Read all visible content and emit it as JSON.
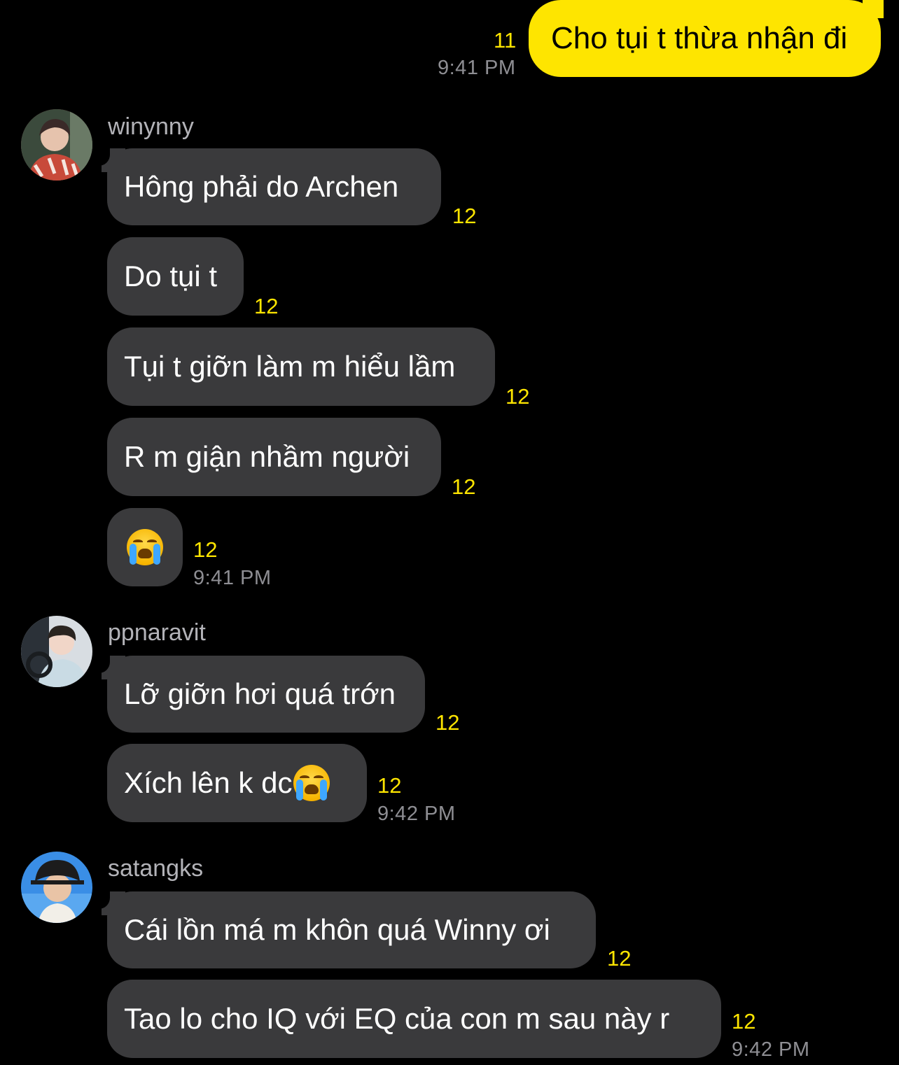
{
  "sent_message": {
    "text": "Cho tụi t thừa nhận đi",
    "read_count": "11",
    "time": "9:41 PM"
  },
  "groups": [
    {
      "sender": "winynny",
      "avatar_icon": "user-avatar-icon",
      "messages": [
        {
          "text": "Hông phải do Archen",
          "read_count": "12"
        },
        {
          "text": "Do tụi t",
          "read_count": "12"
        },
        {
          "text": "Tụi t giỡn làm m hiểu lầm",
          "read_count": "12"
        },
        {
          "text": "R m giận nhầm người",
          "read_count": "12"
        },
        {
          "text": "",
          "emoji": "loudly-crying-face-icon",
          "read_count": "12"
        }
      ],
      "time": "9:41 PM"
    },
    {
      "sender": "ppnaravit",
      "avatar_icon": "user-avatar-icon",
      "messages": [
        {
          "text": "Lỡ giỡn hơi quá trớn",
          "read_count": "12"
        },
        {
          "text": "Xích lên k dc",
          "emoji": "loudly-crying-face-icon",
          "read_count": "12"
        }
      ],
      "time": "9:42 PM"
    },
    {
      "sender": "satangks",
      "avatar_icon": "user-avatar-icon",
      "messages": [
        {
          "text": "Cái lồn má m khôn quá Winny ơi",
          "read_count": "12"
        },
        {
          "text": "Tao lo cho IQ với EQ của con m sau này r",
          "read_count": "12"
        }
      ],
      "time": "9:42 PM"
    }
  ],
  "colors": {
    "background": "#000000",
    "sent_bubble": "#fee500",
    "received_bubble": "#3a3a3c",
    "read_count": "#fee500",
    "timestamp": "#8e8e93"
  }
}
